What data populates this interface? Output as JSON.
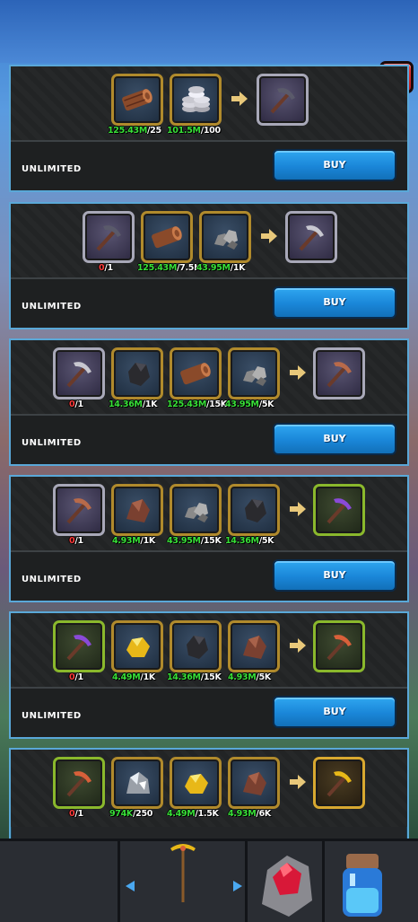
{
  "close_label": "x",
  "recipes": [
    {
      "ingredients": [
        {
          "icon": "log-icon",
          "have": "125.43M",
          "need": "/25"
        },
        {
          "icon": "coins-icon",
          "have": "101.5M",
          "need": "/100"
        }
      ],
      "result_icon": "iron-pickaxe-icon",
      "status": "UNLIMITED",
      "buy_label": "BUY"
    },
    {
      "ingredients": [
        {
          "icon": "pickaxe-icon",
          "have": "0",
          "need": "/1",
          "red": true
        },
        {
          "icon": "log-icon",
          "have": "125.43M",
          "need": "/7.5K"
        },
        {
          "icon": "stone-icon",
          "have": "43.95M",
          "need": "/1K"
        }
      ],
      "result_icon": "stone-pickaxe-icon",
      "status": "UNLIMITED",
      "buy_label": "BUY"
    },
    {
      "ingredients": [
        {
          "icon": "pickaxe-icon",
          "have": "0",
          "need": "/1",
          "red": true
        },
        {
          "icon": "coal-icon",
          "have": "14.36M",
          "need": "/1K"
        },
        {
          "icon": "log-icon",
          "have": "125.43M",
          "need": "/15K"
        },
        {
          "icon": "stone-icon",
          "have": "43.95M",
          "need": "/5K"
        }
      ],
      "result_icon": "copper-pickaxe-icon",
      "status": "UNLIMITED",
      "buy_label": "BUY"
    },
    {
      "ingredients": [
        {
          "icon": "pickaxe-icon",
          "have": "0",
          "need": "/1",
          "red": true
        },
        {
          "icon": "copper-ore-icon",
          "have": "4.93M",
          "need": "/1K"
        },
        {
          "icon": "stone-icon",
          "have": "43.95M",
          "need": "/15K"
        },
        {
          "icon": "coal-icon",
          "have": "14.36M",
          "need": "/5K"
        }
      ],
      "result_icon": "amethyst-pickaxe-icon",
      "status": "UNLIMITED",
      "buy_label": "BUY"
    },
    {
      "ingredients": [
        {
          "icon": "pickaxe-icon",
          "have": "0",
          "need": "/1",
          "red": true
        },
        {
          "icon": "gold-ore-icon",
          "have": "4.49M",
          "need": "/1K"
        },
        {
          "icon": "coal-icon",
          "have": "14.36M",
          "need": "/15K"
        },
        {
          "icon": "copper-ore-icon",
          "have": "4.93M",
          "need": "/5K"
        }
      ],
      "result_icon": "ruby-pickaxe-icon",
      "status": "UNLIMITED",
      "buy_label": "BUY"
    },
    {
      "ingredients": [
        {
          "icon": "pickaxe-icon",
          "have": "0",
          "need": "/1",
          "red": true
        },
        {
          "icon": "silver-ore-icon",
          "have": "974K",
          "need": "/250"
        },
        {
          "icon": "gold-ore-icon",
          "have": "4.49M",
          "need": "/1.5K"
        },
        {
          "icon": "copper-ore-icon",
          "have": "4.93M",
          "need": "/6K"
        }
      ],
      "result_icon": "gold-pickaxe-icon"
    }
  ]
}
